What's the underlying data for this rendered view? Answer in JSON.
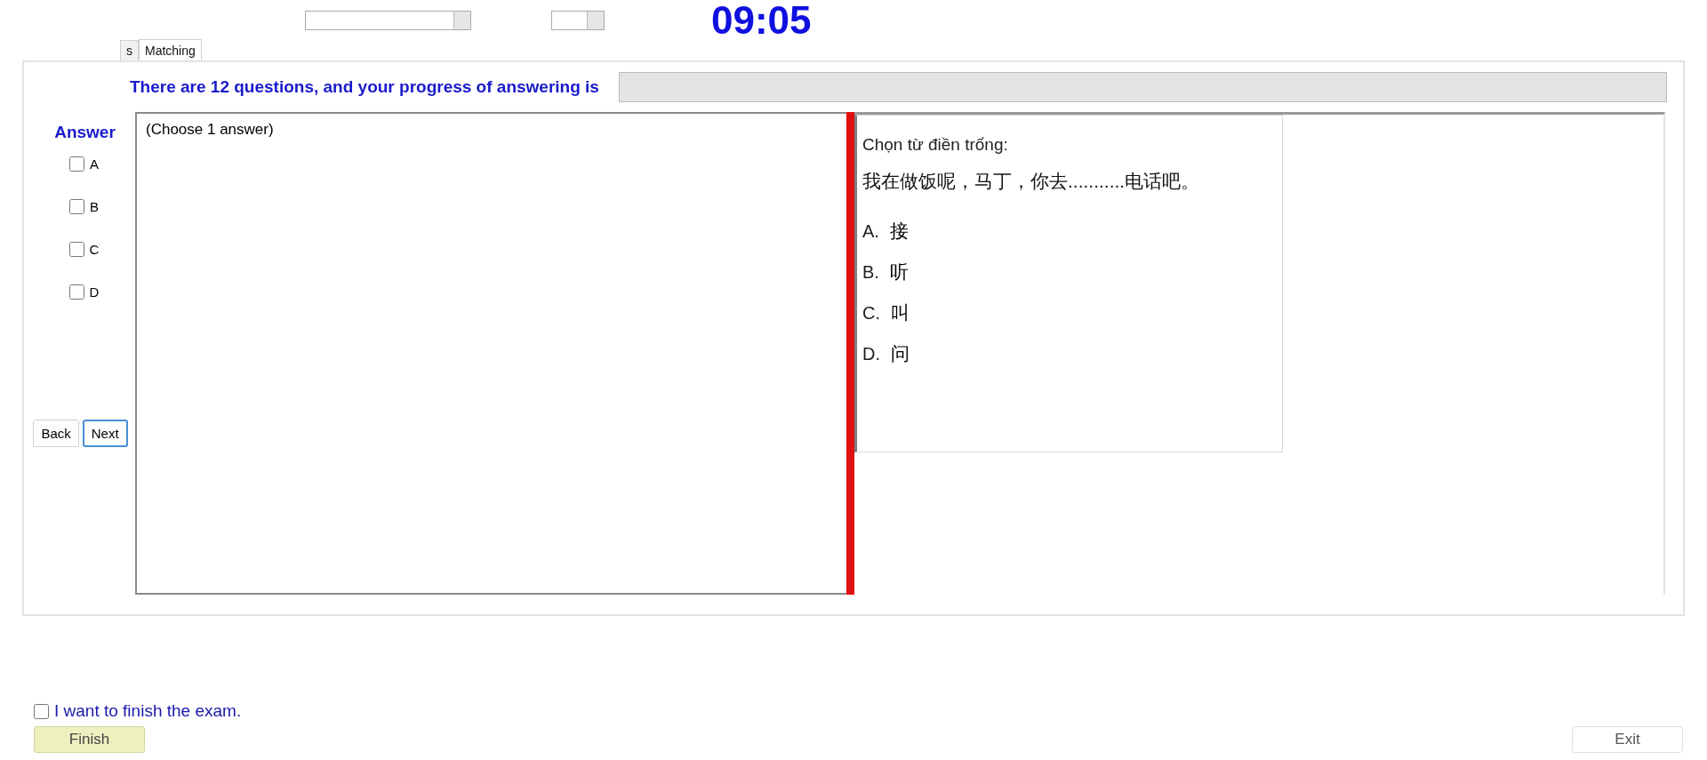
{
  "timer": "09:05",
  "tabs": [
    {
      "label": "s",
      "selected": false
    },
    {
      "label": "Matching",
      "selected": true
    }
  ],
  "progress": {
    "label": "There are 12 questions, and your progress of answering is",
    "level": 0
  },
  "answer": {
    "title": "Answer",
    "options": [
      {
        "label": "A",
        "checked": false
      },
      {
        "label": "B",
        "checked": false
      },
      {
        "label": "C",
        "checked": false
      },
      {
        "label": "D",
        "checked": false
      }
    ]
  },
  "nav_buttons": [
    {
      "label": "Back",
      "focused": false
    },
    {
      "label": "Next",
      "focused": true
    }
  ],
  "answer_text": "(Choose 1 answer)",
  "question": {
    "prompt": "Chọn từ điền trống:",
    "sentence": "我在做饭呢，马丁，你去...........电话吧。",
    "choices": [
      {
        "letter": "A.",
        "text": "接"
      },
      {
        "letter": "B.",
        "text": "听"
      },
      {
        "letter": "C.",
        "text": "叫"
      },
      {
        "letter": "D.",
        "text": "问"
      }
    ]
  },
  "finish": {
    "label": "I want to finish the exam.",
    "checked": false,
    "button": "Finish"
  },
  "exit_button": "Exit"
}
